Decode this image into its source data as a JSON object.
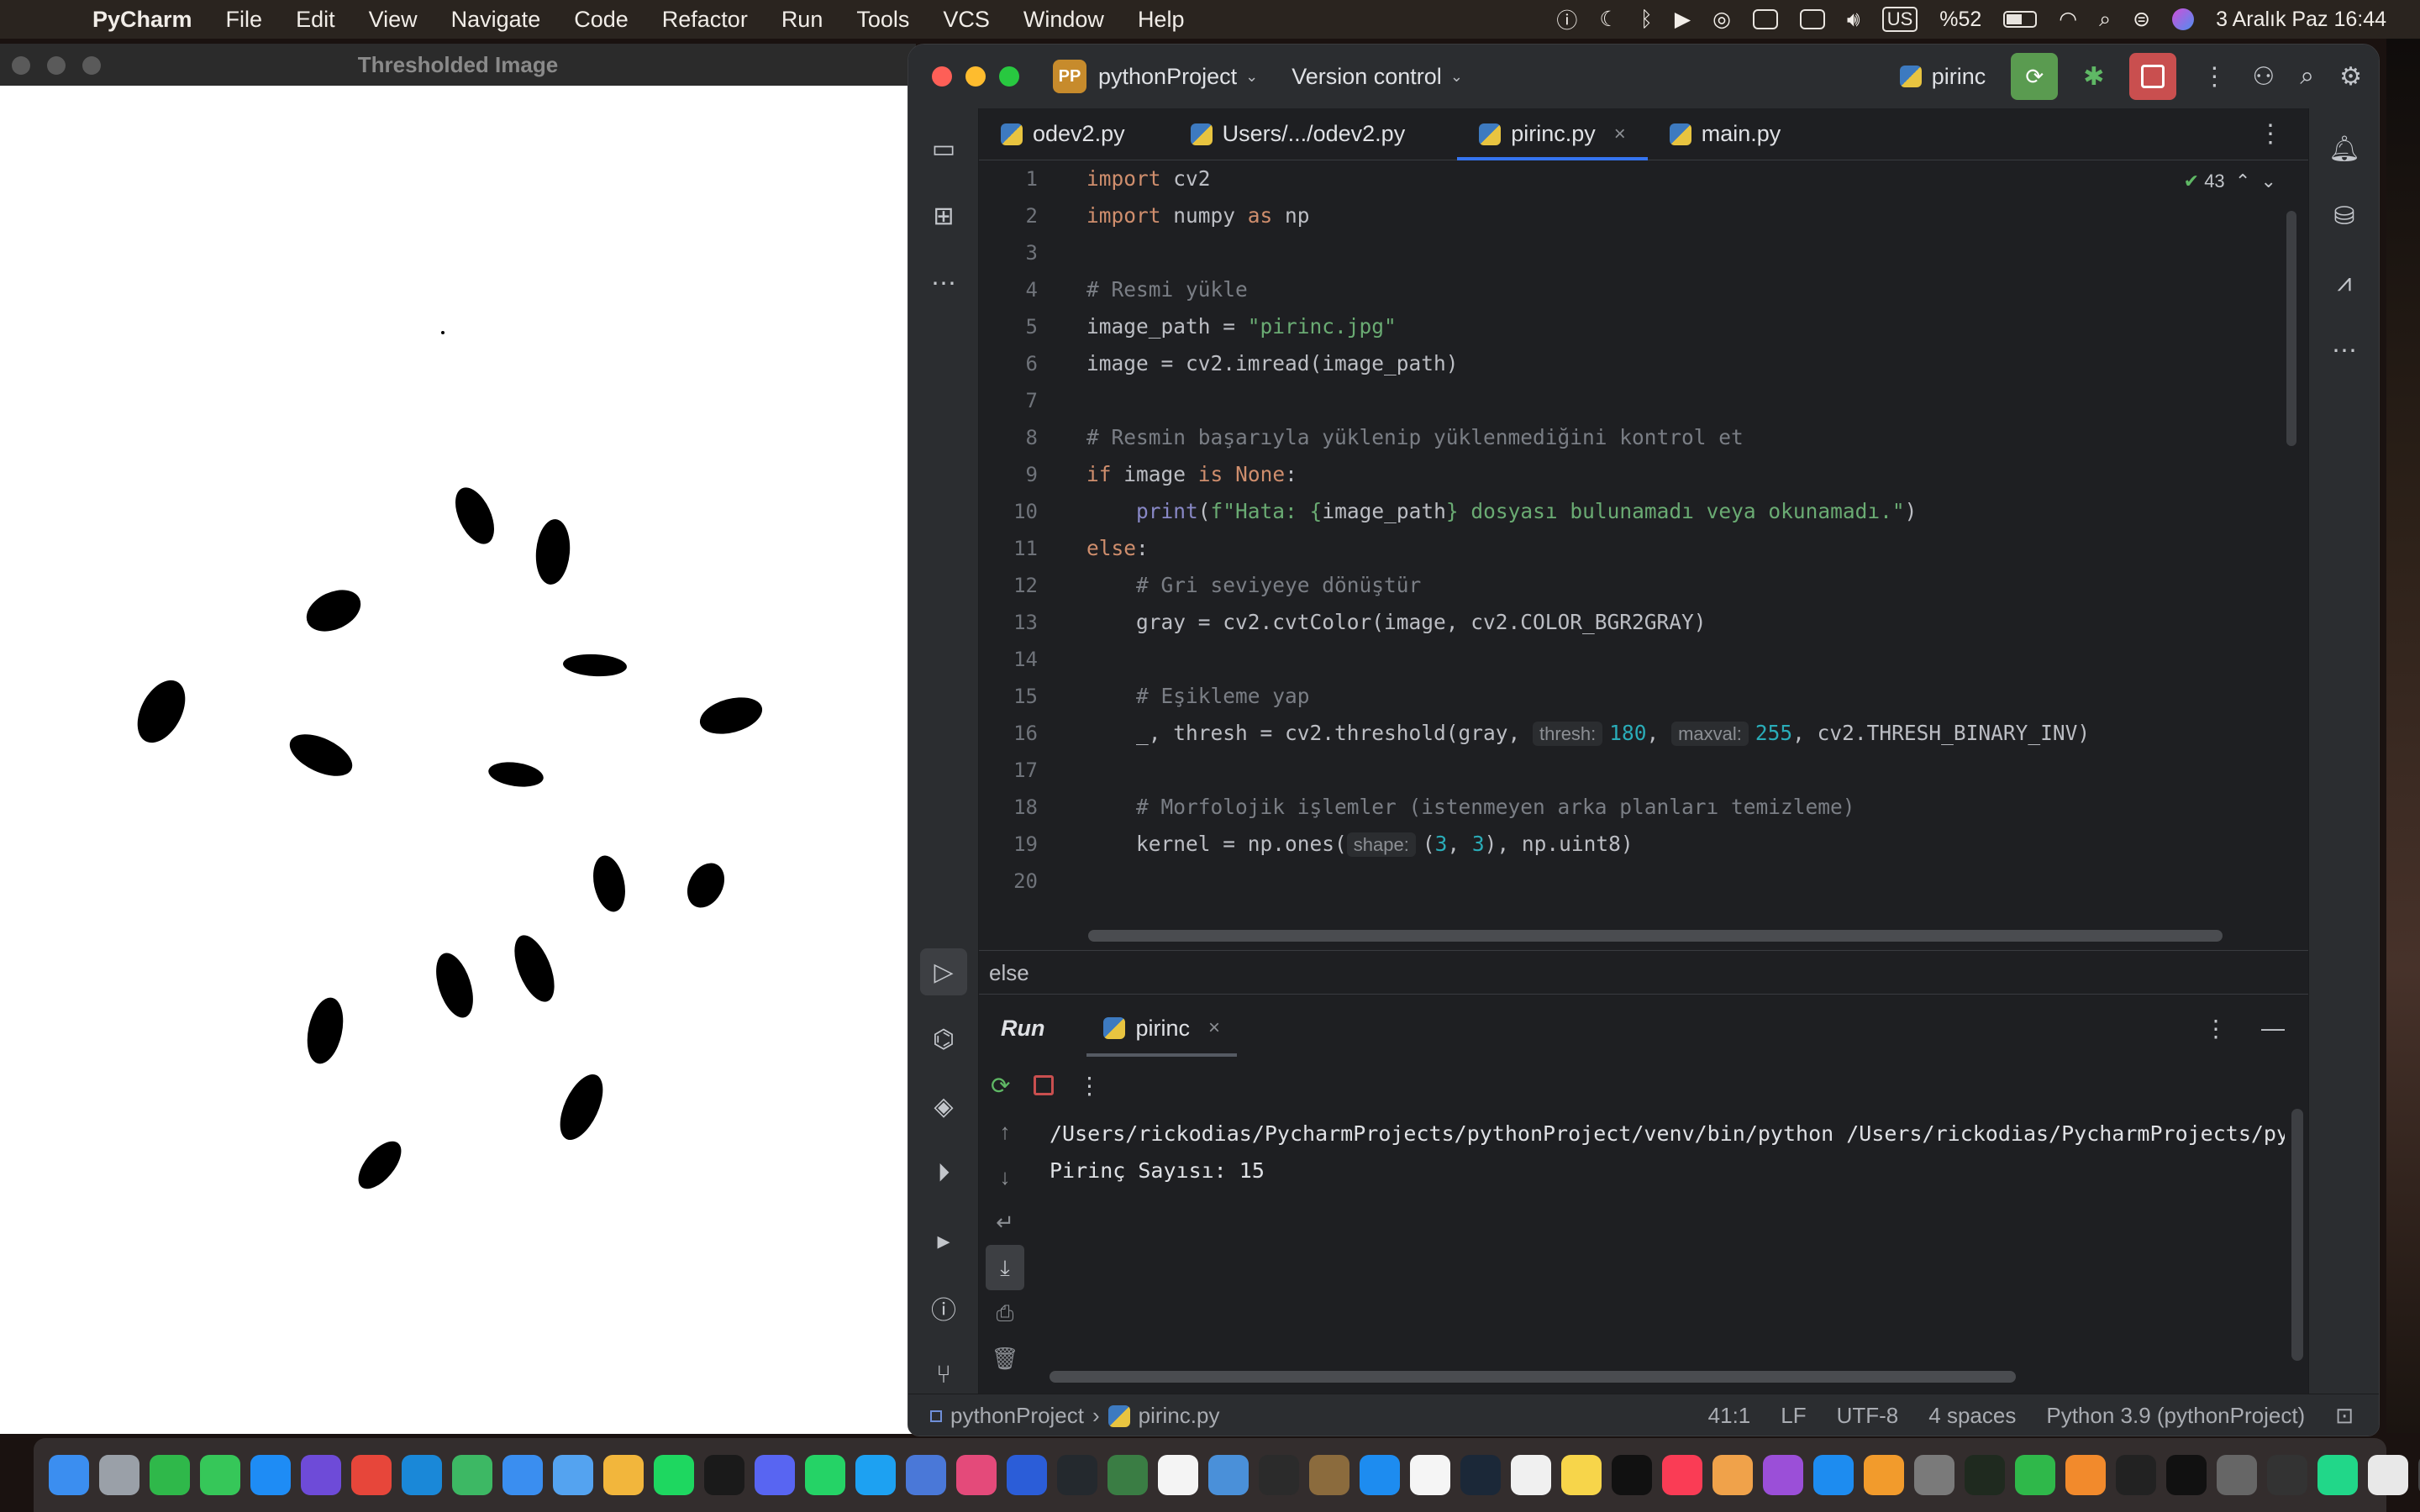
{
  "menubar": {
    "app": "PyCharm",
    "items": [
      "File",
      "Edit",
      "View",
      "Navigate",
      "Code",
      "Refactor",
      "Run",
      "Tools",
      "VCS",
      "Window",
      "Help"
    ],
    "keyboard": "US",
    "battery": "%52",
    "datetime": "3 Aralık Paz  16:44"
  },
  "image_window": {
    "title": "Thresholded Image"
  },
  "pycharm": {
    "badge": "PP",
    "project": "pythonProject",
    "vcs": "Version control",
    "run_config": "pirinc",
    "tabs": [
      {
        "label": "odev2.py"
      },
      {
        "label": "Users/.../odev2.py"
      },
      {
        "label": "pirinc.py"
      },
      {
        "label": "main.py"
      }
    ],
    "inspections": "43",
    "line_numbers": [
      "1",
      "2",
      "3",
      "4",
      "5",
      "6",
      "7",
      "8",
      "9",
      "10",
      "11",
      "12",
      "13",
      "14",
      "15",
      "16",
      "17",
      "18",
      "19",
      "20"
    ],
    "breadcrumb": "else",
    "run_panel": {
      "title": "Run",
      "tab": "pirinc",
      "console": [
        "/Users/rickodias/PycharmProjects/pythonProject/venv/bin/python /Users/rickodias/PycharmProjects/pythonProject/pirinc.py",
        "Pirinç Sayısı: 15"
      ]
    },
    "status": {
      "project": "pythonProject",
      "file": "pirinc.py",
      "position": "41:1",
      "line_sep": "LF",
      "encoding": "UTF-8",
      "indent": "4 spaces",
      "interpreter": "Python 3.9 (pythonProject)"
    }
  },
  "code": {
    "l1a": "import",
    "l1b": " cv2",
    "l2a": "import",
    "l2b": " numpy ",
    "l2c": "as",
    "l2d": " np",
    "l4": "# Resmi yükle",
    "l5a": "image_path = ",
    "l5b": "\"pirinc.jpg\"",
    "l6": "image = cv2.imread(image_path)",
    "l8": "# Resmin başarıyla yüklenip yüklenmediğini kontrol et",
    "l9a": "if",
    "l9b": " image ",
    "l9c": "is",
    "l9d": " ",
    "l9e": "None",
    "l9f": ":",
    "l10a": "    ",
    "l10b": "print",
    "l10c": "(",
    "l10d": "f\"Hata: {",
    "l10e": "image_path",
    "l10f": "} dosyası bulunamadı veya okunamadı.\"",
    "l10g": ")",
    "l11a": "else",
    "l11b": ":",
    "l12": "    # Gri seviyeye dönüştür",
    "l13": "    gray = cv2.cvtColor(image, cv2.COLOR_BGR2GRAY)",
    "l15": "    # Eşikleme yap",
    "l16a": "    _, thresh = cv2.threshold(gray, ",
    "l16h1": "thresh:",
    "l16n1": "180",
    "l16c": ", ",
    "l16h2": "maxval:",
    "l16n2": "255",
    "l16d": ", cv2.THRESH_BINARY_INV)",
    "l18": "    # Morfolojik işlemler (istenmeyen arka planları temizleme)",
    "l19a": "    kernel = np.ones(",
    "l19h": "shape:",
    "l19b": "(",
    "l19n1": "3",
    "l19c": ", ",
    "l19n2": "3",
    "l19d": "), np.uint8)"
  },
  "colors": {
    "accent": "#3574f0",
    "run_green": "#5a9b50",
    "stop_red": "#c94f4f"
  }
}
